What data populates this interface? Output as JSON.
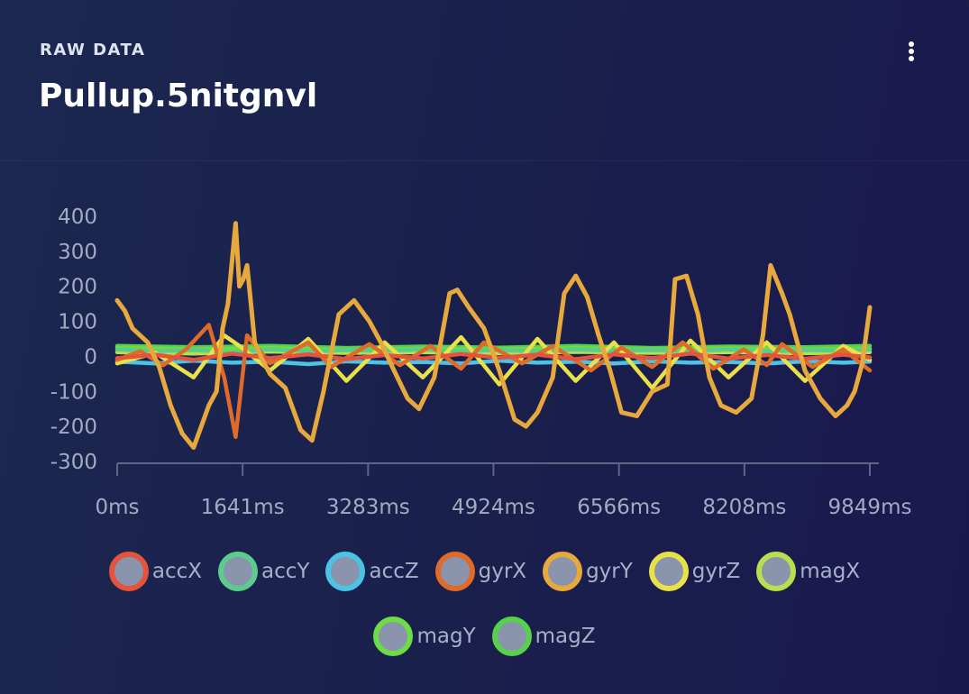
{
  "header": {
    "eyebrow": "RAW DATA",
    "title": "Pullup.5nitgnvl",
    "menu_icon": "more-vertical-icon"
  },
  "chart_data": {
    "type": "line",
    "title": "",
    "xlabel": "",
    "ylabel": "",
    "xlim": [
      0,
      9849
    ],
    "ylim": [
      -300,
      400
    ],
    "grid": false,
    "legend_position": "bottom",
    "x_ticks": [
      "0ms",
      "1641ms",
      "3283ms",
      "4924ms",
      "6566ms",
      "8208ms",
      "9849ms"
    ],
    "y_ticks": [
      "400",
      "300",
      "200",
      "100",
      "0",
      "-100",
      "-200",
      "-300"
    ],
    "series": [
      {
        "name": "accX",
        "color": "#e4533c",
        "x": [
          0,
          500,
          1000,
          1500,
          2000,
          2500,
          3000,
          3500,
          4000,
          4500,
          5000,
          5500,
          6000,
          6500,
          7000,
          7500,
          8000,
          8500,
          9000,
          9500,
          9849
        ],
        "y": [
          -5,
          5,
          -10,
          8,
          -5,
          6,
          -8,
          4,
          -6,
          7,
          -4,
          5,
          -8,
          6,
          -5,
          8,
          -6,
          4,
          -7,
          5,
          -3
        ]
      },
      {
        "name": "accY",
        "color": "#5ccc8c",
        "x": [
          0,
          500,
          1000,
          1500,
          2000,
          2500,
          3000,
          3500,
          4000,
          4500,
          5000,
          5500,
          6000,
          6500,
          7000,
          7500,
          8000,
          8500,
          9000,
          9500,
          9849
        ],
        "y": [
          20,
          15,
          18,
          12,
          20,
          14,
          18,
          16,
          20,
          15,
          18,
          14,
          20,
          16,
          18,
          15,
          20,
          14,
          18,
          16,
          20
        ]
      },
      {
        "name": "accZ",
        "color": "#4cc3e5",
        "x": [
          0,
          500,
          1000,
          1500,
          2000,
          2500,
          3000,
          3500,
          4000,
          4500,
          5000,
          5500,
          6000,
          6500,
          7000,
          7500,
          8000,
          8500,
          9000,
          9500,
          9849
        ],
        "y": [
          -15,
          -20,
          -12,
          -18,
          -15,
          -22,
          -14,
          -18,
          -16,
          -20,
          -12,
          -18,
          -15,
          -20,
          -14,
          -18,
          -16,
          -20,
          -14,
          -18,
          -15
        ]
      },
      {
        "name": "gyrX",
        "color": "#de6b2a",
        "x": [
          0,
          300,
          600,
          900,
          1200,
          1400,
          1550,
          1700,
          2000,
          2500,
          2800,
          3300,
          3700,
          4100,
          4500,
          4800,
          5300,
          5700,
          6200,
          6600,
          7000,
          7400,
          7800,
          8200,
          8500,
          8700,
          9100,
          9500,
          9849
        ],
        "y": [
          -10,
          15,
          -25,
          20,
          90,
          -60,
          -230,
          60,
          -20,
          40,
          -30,
          35,
          -25,
          30,
          -35,
          40,
          -20,
          30,
          -40,
          25,
          -30,
          40,
          -35,
          20,
          -25,
          35,
          -30,
          20,
          -40
        ]
      },
      {
        "name": "gyrY",
        "color": "#e8a93c",
        "x": [
          0,
          100,
          200,
          400,
          550,
          700,
          850,
          1000,
          1100,
          1200,
          1300,
          1380,
          1450,
          1550,
          1600,
          1650,
          1700,
          1750,
          1800,
          1900,
          2000,
          2200,
          2400,
          2550,
          2700,
          2900,
          3100,
          3300,
          3450,
          3600,
          3800,
          3950,
          4150,
          4350,
          4450,
          4600,
          4800,
          5000,
          5200,
          5350,
          5500,
          5700,
          5850,
          6000,
          6150,
          6300,
          6450,
          6600,
          6800,
          7000,
          7200,
          7300,
          7450,
          7600,
          7750,
          7900,
          8100,
          8300,
          8450,
          8550,
          8700,
          8800,
          9000,
          9200,
          9400,
          9550,
          9650,
          9750,
          9849
        ],
        "y": [
          160,
          130,
          80,
          40,
          -30,
          -140,
          -220,
          -260,
          -200,
          -140,
          -100,
          80,
          150,
          380,
          200,
          220,
          260,
          150,
          40,
          -10,
          -50,
          -90,
          -210,
          -240,
          -100,
          120,
          160,
          100,
          40,
          -30,
          -120,
          -150,
          -60,
          180,
          190,
          140,
          80,
          -40,
          -180,
          -200,
          -160,
          -60,
          180,
          230,
          170,
          60,
          -40,
          -160,
          -170,
          -100,
          -80,
          220,
          230,
          120,
          -60,
          -140,
          -160,
          -120,
          60,
          260,
          180,
          120,
          -40,
          -120,
          -170,
          -140,
          -100,
          -20,
          140
        ]
      },
      {
        "name": "gyrZ",
        "color": "#e8e14a",
        "x": [
          0,
          500,
          1000,
          1400,
          1600,
          2000,
          2500,
          3000,
          3500,
          4000,
          4500,
          5000,
          5500,
          6000,
          6500,
          7000,
          7500,
          8000,
          8500,
          9000,
          9500,
          9849
        ],
        "y": [
          -20,
          10,
          -60,
          60,
          30,
          -40,
          50,
          -70,
          40,
          -60,
          55,
          -80,
          50,
          -70,
          40,
          -90,
          45,
          -60,
          40,
          -70,
          30,
          -10
        ]
      },
      {
        "name": "magX",
        "color": "#b8e04e",
        "x": [
          0,
          1000,
          2000,
          3000,
          4000,
          5000,
          6000,
          7000,
          8000,
          9000,
          9849
        ],
        "y": [
          12,
          8,
          14,
          10,
          12,
          9,
          13,
          10,
          12,
          9,
          12
        ]
      },
      {
        "name": "magY",
        "color": "#6ddc45",
        "x": [
          0,
          1000,
          2000,
          3000,
          4000,
          5000,
          6000,
          7000,
          8000,
          9000,
          9849
        ],
        "y": [
          25,
          20,
          24,
          18,
          22,
          20,
          24,
          19,
          23,
          20,
          22
        ]
      },
      {
        "name": "magZ",
        "color": "#55d24a",
        "x": [
          0,
          1000,
          2000,
          3000,
          4000,
          5000,
          6000,
          7000,
          8000,
          9000,
          9849
        ],
        "y": [
          30,
          26,
          30,
          24,
          28,
          25,
          30,
          24,
          28,
          26,
          30
        ]
      }
    ]
  }
}
